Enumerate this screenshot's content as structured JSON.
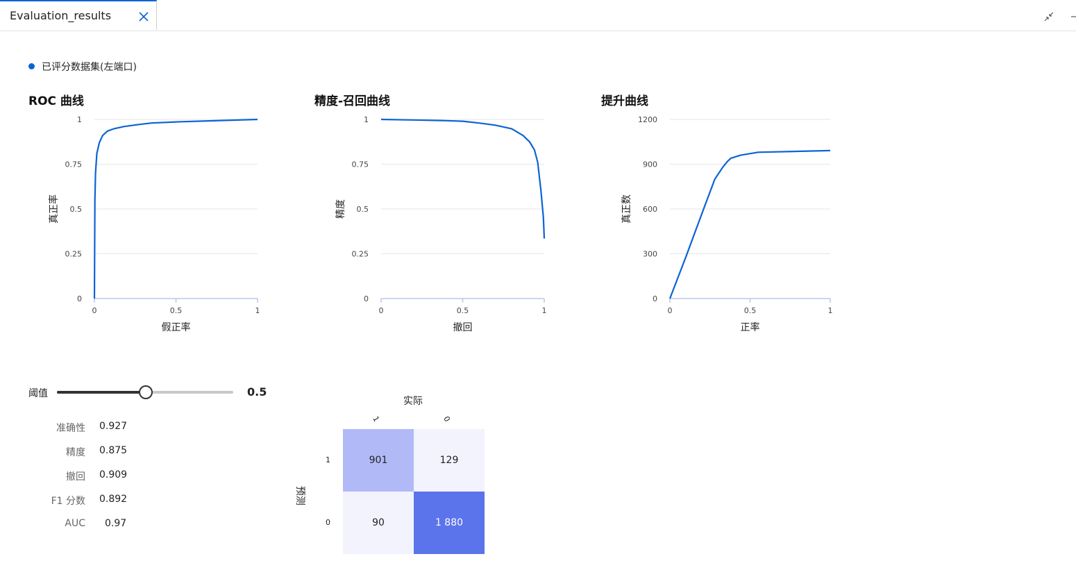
{
  "tab": {
    "title": "Evaluation_results"
  },
  "legend": {
    "label": "已评分数据集(左端口)",
    "color": "#0b63d6"
  },
  "roc": {
    "title": "ROC 曲线",
    "chart_data": {
      "type": "line",
      "title": "ROC 曲线",
      "xlabel": "假正率",
      "ylabel": "真正率",
      "xlim": [
        0,
        1
      ],
      "ylim": [
        0,
        1
      ],
      "xticks": [
        "0",
        "0.5",
        "1"
      ],
      "yticks": [
        "0",
        "0.25",
        "0.5",
        "0.75",
        "1"
      ],
      "grid": true,
      "x": [
        0,
        0.003,
        0.007,
        0.015,
        0.03,
        0.05,
        0.08,
        0.12,
        0.18,
        0.26,
        0.35,
        0.5,
        0.7,
        1
      ],
      "y": [
        0,
        0.55,
        0.7,
        0.81,
        0.87,
        0.91,
        0.935,
        0.948,
        0.96,
        0.97,
        0.98,
        0.986,
        0.992,
        1
      ]
    }
  },
  "pr": {
    "title": "精度-召回曲线",
    "chart_data": {
      "type": "line",
      "title": "精度-召回曲线",
      "xlabel": "撤回",
      "ylabel": "精度",
      "xlim": [
        0,
        1
      ],
      "ylim": [
        0,
        1
      ],
      "xticks": [
        "0",
        "0.5",
        "1"
      ],
      "yticks": [
        "0",
        "0.25",
        "0.5",
        "0.75",
        "1"
      ],
      "grid": true,
      "x": [
        0,
        0.2,
        0.4,
        0.5,
        0.6,
        0.7,
        0.8,
        0.87,
        0.91,
        0.94,
        0.96,
        0.98,
        0.995,
        1
      ],
      "y": [
        1,
        0.997,
        0.993,
        0.99,
        0.98,
        0.968,
        0.948,
        0.91,
        0.875,
        0.83,
        0.76,
        0.6,
        0.45,
        0.335
      ]
    }
  },
  "lift": {
    "title": "提升曲线",
    "chart_data": {
      "type": "line",
      "title": "提升曲线",
      "xlabel": "正率",
      "ylabel": "真正数",
      "xlim": [
        0,
        1
      ],
      "ylim": [
        0,
        1200
      ],
      "xticks": [
        "0",
        "0.5",
        "1"
      ],
      "yticks": [
        "0",
        "300",
        "600",
        "900",
        "1200"
      ],
      "grid": true,
      "x": [
        0,
        0.1,
        0.2,
        0.28,
        0.33,
        0.36,
        0.38,
        0.44,
        0.55,
        1
      ],
      "y": [
        0,
        280,
        570,
        800,
        880,
        920,
        940,
        960,
        980,
        991
      ]
    }
  },
  "threshold": {
    "label": "阈值",
    "value": 0.5,
    "value_text": "0.5"
  },
  "metrics": [
    {
      "name": "准确性",
      "value": "0.927"
    },
    {
      "name": "精度",
      "value": "0.875"
    },
    {
      "name": "撤回",
      "value": "0.909"
    },
    {
      "name": "F1 分数",
      "value": "0.892"
    },
    {
      "name": "AUC",
      "value": "0.97"
    }
  ],
  "confusion": {
    "actual_label": "实际",
    "predicted_label": "预测",
    "cols": [
      "1",
      "0"
    ],
    "rows": [
      "1",
      "0"
    ],
    "cells": [
      [
        "901",
        "129"
      ],
      [
        "90",
        "1 880"
      ]
    ],
    "colors": [
      [
        "#b1baf7",
        "#f2f3fd"
      ],
      [
        "#f2f3fd",
        "#5b74ec"
      ]
    ],
    "text_colors": [
      [
        "#222222",
        "#222222"
      ],
      [
        "#222222",
        "#ffffff"
      ]
    ]
  }
}
